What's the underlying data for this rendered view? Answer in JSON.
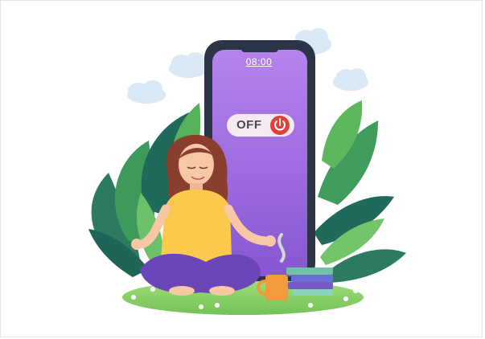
{
  "phone": {
    "clock": "08:00",
    "toggle_label": "OFF"
  },
  "colors": {
    "screen_top": "#b07ee9",
    "screen_bottom": "#8a58d6",
    "phone_frame": "#2c3447",
    "power_red": "#e0403a",
    "shirt": "#fbc94c",
    "hair": "#8a3f2e",
    "pants": "#6a46b8",
    "grass": "#8ed46c",
    "leaf_dark": "#1f6a5a",
    "leaf_light": "#4aa558",
    "mug": "#f19a3e",
    "cloud": "#dbe8f6"
  }
}
